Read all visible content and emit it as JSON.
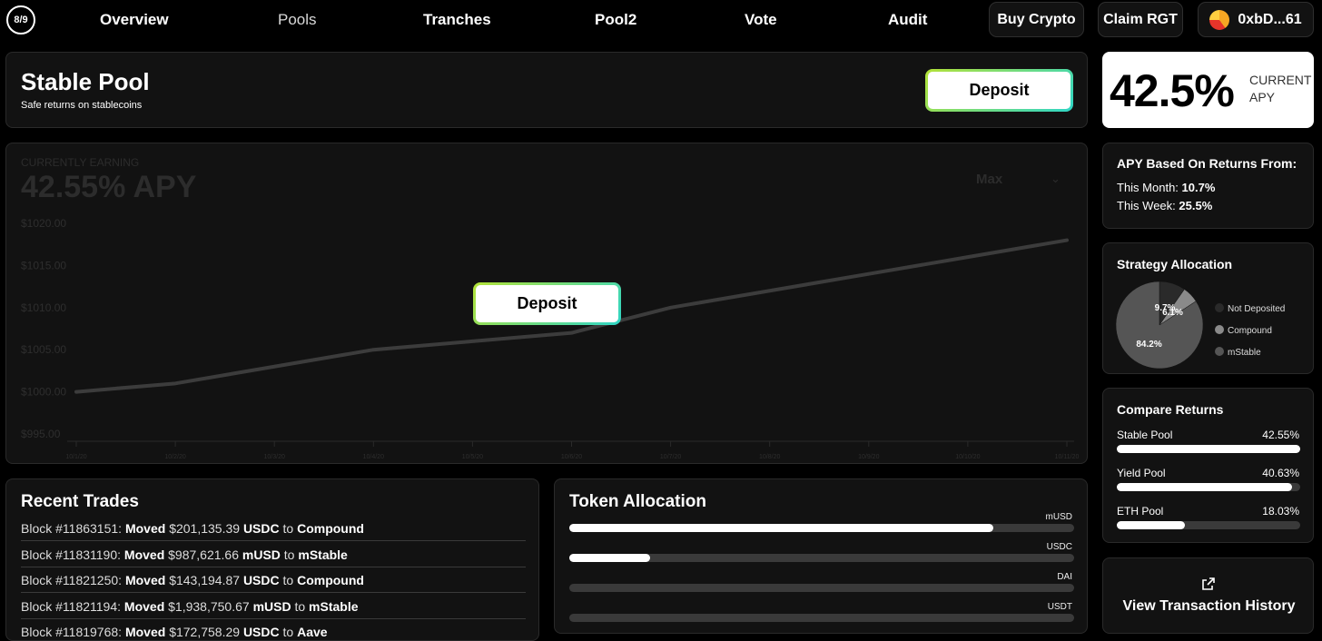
{
  "nav": {
    "logo_text": "8/9",
    "links": [
      "Overview",
      "Pools",
      "Tranches",
      "Pool2",
      "Vote",
      "Audit"
    ],
    "buy_crypto": "Buy Crypto",
    "claim_rgt": "Claim RGT",
    "wallet": "0xbD...61"
  },
  "header": {
    "title": "Stable Pool",
    "subtitle": "Safe returns on stablecoins",
    "deposit_label": "Deposit"
  },
  "apy_box": {
    "value": "42.5%",
    "label": "CURRENT APY"
  },
  "chart": {
    "overlay_deposit_label": "Deposit",
    "earning_label": "CURRENTLY EARNING",
    "earning_value": "42.55% APY",
    "range_value": "Max",
    "chevron_icon": "chevron-down-icon"
  },
  "chart_data": {
    "type": "line",
    "title": "",
    "x": [
      "10/1/20",
      "10/2/20",
      "10/3/20",
      "10/4/20",
      "10/5/20",
      "10/6/20",
      "10/7/20",
      "10/8/20",
      "10/9/20",
      "10/10/20",
      "10/11/20"
    ],
    "y_ticks": [
      "$1020.00",
      "$1015.00",
      "$1010.00",
      "$1005.00",
      "$1000.00",
      "$995.00"
    ],
    "ylim": [
      995,
      1020
    ],
    "series": [
      {
        "values": [
          1000.0,
          1001.0,
          1003.0,
          1005.0,
          1006.0,
          1007.0,
          1010.0,
          1012.0,
          1014.0,
          1016.0,
          1018.0
        ]
      }
    ],
    "grid": false,
    "line_color": "#3c3c3c"
  },
  "apy_returns": {
    "title": "APY Based On Returns From:",
    "month_label": "This Month:",
    "month_value": "10.7%",
    "week_label": "This Week:",
    "week_value": "25.5%"
  },
  "strategy": {
    "title": "Strategy Allocation",
    "slices": [
      {
        "label": "Not Deposited",
        "value": 9.7,
        "text": "9.7%",
        "color": "#2a2a2a"
      },
      {
        "label": "Compound",
        "value": 6.1,
        "text": "6.1%",
        "color": "#8a8a8a"
      },
      {
        "label": "mStable",
        "value": 84.2,
        "text": "84.2%",
        "color": "#555555"
      }
    ]
  },
  "compare": {
    "title": "Compare Returns",
    "rows": [
      {
        "name": "Stable Pool",
        "value": "42.55%",
        "fraction": 1.0
      },
      {
        "name": "Yield Pool",
        "value": "40.63%",
        "fraction": 0.955
      },
      {
        "name": "ETH Pool",
        "value": "18.03%",
        "fraction": 0.37
      }
    ]
  },
  "history": {
    "label": "View Transaction History",
    "icon": "external-link-icon"
  },
  "trades": {
    "title": "Recent Trades",
    "rows": [
      {
        "block": "Block #11863151:",
        "action": "Moved",
        "amount": "$201,135.39",
        "token": "USDC",
        "to": "to",
        "dest": "Compound"
      },
      {
        "block": "Block #11831190:",
        "action": "Moved",
        "amount": "$987,621.66",
        "token": "mUSD",
        "to": "to",
        "dest": "mStable"
      },
      {
        "block": "Block #11821250:",
        "action": "Moved",
        "amount": "$143,194.87",
        "token": "USDC",
        "to": "to",
        "dest": "Compound"
      },
      {
        "block": "Block #11821194:",
        "action": "Moved",
        "amount": "$1,938,750.67",
        "token": "mUSD",
        "to": "to",
        "dest": "mStable"
      },
      {
        "block": "Block #11819768:",
        "action": "Moved",
        "amount": "$172,758.29",
        "token": "USDC",
        "to": "to",
        "dest": "Aave"
      }
    ]
  },
  "tokens": {
    "title": "Token Allocation",
    "rows": [
      {
        "name": "mUSD",
        "fraction": 0.84
      },
      {
        "name": "USDC",
        "fraction": 0.16
      },
      {
        "name": "DAI",
        "fraction": 0.0
      },
      {
        "name": "USDT",
        "fraction": 0.0
      }
    ]
  }
}
